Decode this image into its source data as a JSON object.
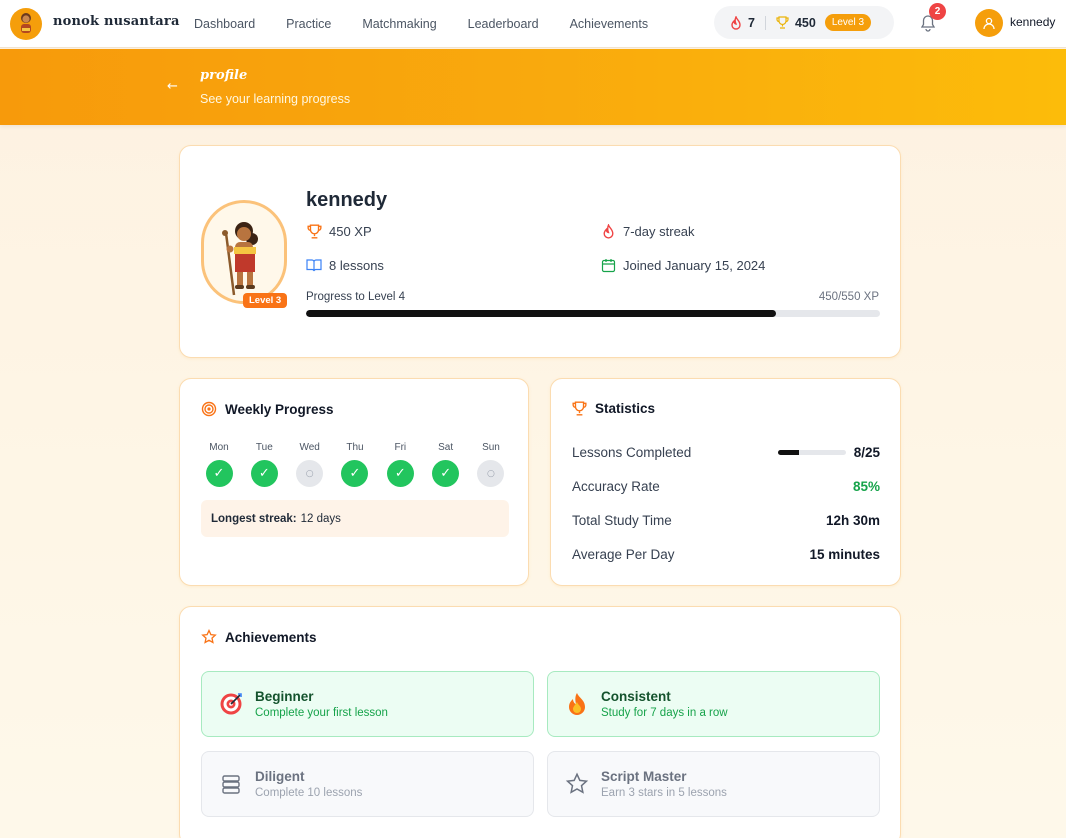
{
  "nav": {
    "brand": "nonok nusantara",
    "links": [
      "Dashboard",
      "Practice",
      "Matchmaking",
      "Leaderboard",
      "Achievements"
    ],
    "streak": "7",
    "xp": "450",
    "level": "Level 3",
    "notifications": "2",
    "username": "kennedy",
    "icons": {
      "streak": "flame-icon",
      "xp": "trophy-icon",
      "bell": "bell-icon",
      "user": "user-icon"
    }
  },
  "header": {
    "title": "profile",
    "subtitle": "See your learning progress"
  },
  "profile": {
    "name": "kennedy",
    "xp": "450 XP",
    "streak": "7-day streak",
    "lessons": "8 lessons",
    "joined": "Joined January 15, 2024",
    "level_badge": "Level 3",
    "progress_label": "Progress to Level 4",
    "progress_value": "450/550 XP",
    "progress_fraction": 0.818
  },
  "weekly": {
    "title": "Weekly Progress",
    "days": [
      {
        "label": "Mon",
        "done": true
      },
      {
        "label": "Tue",
        "done": true
      },
      {
        "label": "Wed",
        "done": false
      },
      {
        "label": "Thu",
        "done": true
      },
      {
        "label": "Fri",
        "done": true
      },
      {
        "label": "Sat",
        "done": true
      },
      {
        "label": "Sun",
        "done": false
      }
    ],
    "done_mark": "✓",
    "miss_mark": "○",
    "longest_label": "Longest streak:",
    "longest_value": "12 days"
  },
  "statistics": {
    "title": "Statistics",
    "rows": [
      {
        "label": "Lessons Completed",
        "value": "8/25",
        "fraction": 0.32
      },
      {
        "label": "Accuracy Rate",
        "value": "85%"
      },
      {
        "label": "Total Study Time",
        "value": "12h 30m"
      },
      {
        "label": "Average Per Day",
        "value": "15 minutes"
      }
    ]
  },
  "achievements": {
    "title": "Achievements",
    "items": [
      {
        "name": "Beginner",
        "desc": "Complete your first lesson",
        "unlocked": true,
        "icon": "target-icon"
      },
      {
        "name": "Consistent",
        "desc": "Study for 7 days in a row",
        "unlocked": true,
        "icon": "flame-icon"
      },
      {
        "name": "Diligent",
        "desc": "Complete 10 lessons",
        "unlocked": false,
        "icon": "books-icon"
      },
      {
        "name": "Script Master",
        "desc": "Earn 3 stars in 5 lessons",
        "unlocked": false,
        "icon": "star-icon"
      }
    ]
  },
  "colors": {
    "accent": "#f59e0b",
    "orange": "#f97316",
    "success": "#22c55e",
    "danger": "#ef4444"
  }
}
